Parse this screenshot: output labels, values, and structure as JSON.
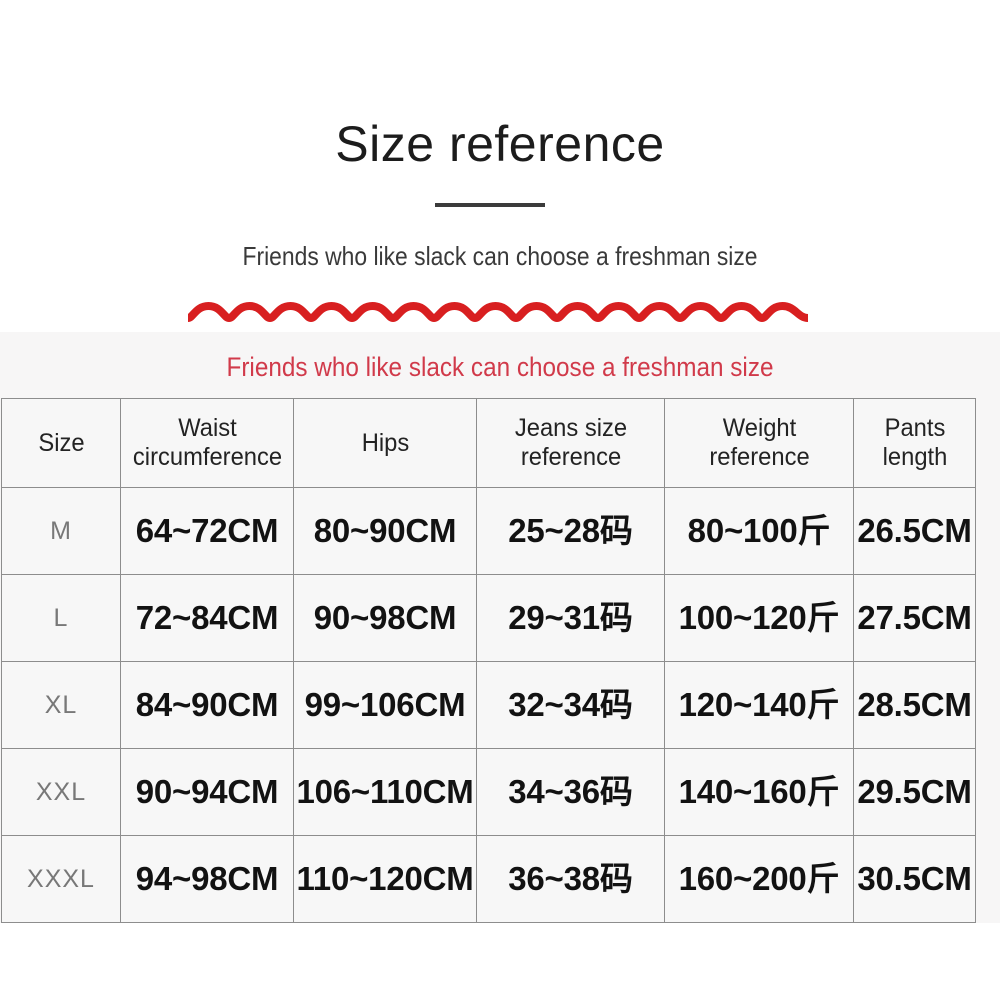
{
  "header": {
    "title": "Size reference",
    "subtitle": "Friends who like slack can choose a freshman size",
    "red_caption": "Friends who like slack can choose a freshman size",
    "accent_color": "#d81f20",
    "caption_color": "#d13a4a",
    "underline_color": "#3b3b3b",
    "band_color": "#f7f6f6"
  },
  "table": {
    "columns": [
      "Size",
      "Waist circumference",
      "Hips",
      "Jeans size reference",
      "Weight reference",
      "Pants length"
    ],
    "rows": [
      {
        "size": "M",
        "waist": "64~72CM",
        "hips": "80~90CM",
        "jeans": "25~28码",
        "weight": "80~100斤",
        "pants": "26.5CM"
      },
      {
        "size": "L",
        "waist": "72~84CM",
        "hips": "90~98CM",
        "jeans": "29~31码",
        "weight": "100~120斤",
        "pants": "27.5CM"
      },
      {
        "size": "XL",
        "waist": "84~90CM",
        "hips": "99~106CM",
        "jeans": "32~34码",
        "weight": "120~140斤",
        "pants": "28.5CM"
      },
      {
        "size": "XXL",
        "waist": "90~94CM",
        "hips": "106~110CM",
        "jeans": "34~36码",
        "weight": "140~160斤",
        "pants": "29.5CM"
      },
      {
        "size": "XXXL",
        "waist": "94~98CM",
        "hips": "110~120CM",
        "jeans": "36~38码",
        "weight": "160~200斤",
        "pants": "30.5CM"
      }
    ]
  }
}
